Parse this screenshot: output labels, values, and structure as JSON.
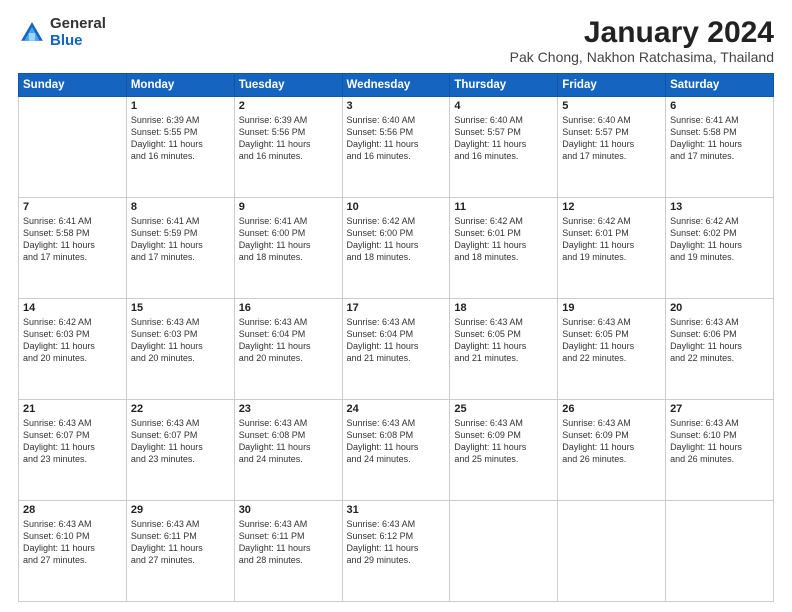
{
  "logo": {
    "general": "General",
    "blue": "Blue"
  },
  "title": {
    "month_year": "January 2024",
    "location": "Pak Chong, Nakhon Ratchasima, Thailand"
  },
  "weekdays": [
    "Sunday",
    "Monday",
    "Tuesday",
    "Wednesday",
    "Thursday",
    "Friday",
    "Saturday"
  ],
  "weeks": [
    [
      {
        "day": "",
        "info": ""
      },
      {
        "day": "1",
        "info": "Sunrise: 6:39 AM\nSunset: 5:55 PM\nDaylight: 11 hours\nand 16 minutes."
      },
      {
        "day": "2",
        "info": "Sunrise: 6:39 AM\nSunset: 5:56 PM\nDaylight: 11 hours\nand 16 minutes."
      },
      {
        "day": "3",
        "info": "Sunrise: 6:40 AM\nSunset: 5:56 PM\nDaylight: 11 hours\nand 16 minutes."
      },
      {
        "day": "4",
        "info": "Sunrise: 6:40 AM\nSunset: 5:57 PM\nDaylight: 11 hours\nand 16 minutes."
      },
      {
        "day": "5",
        "info": "Sunrise: 6:40 AM\nSunset: 5:57 PM\nDaylight: 11 hours\nand 17 minutes."
      },
      {
        "day": "6",
        "info": "Sunrise: 6:41 AM\nSunset: 5:58 PM\nDaylight: 11 hours\nand 17 minutes."
      }
    ],
    [
      {
        "day": "7",
        "info": "Sunrise: 6:41 AM\nSunset: 5:58 PM\nDaylight: 11 hours\nand 17 minutes."
      },
      {
        "day": "8",
        "info": "Sunrise: 6:41 AM\nSunset: 5:59 PM\nDaylight: 11 hours\nand 17 minutes."
      },
      {
        "day": "9",
        "info": "Sunrise: 6:41 AM\nSunset: 6:00 PM\nDaylight: 11 hours\nand 18 minutes."
      },
      {
        "day": "10",
        "info": "Sunrise: 6:42 AM\nSunset: 6:00 PM\nDaylight: 11 hours\nand 18 minutes."
      },
      {
        "day": "11",
        "info": "Sunrise: 6:42 AM\nSunset: 6:01 PM\nDaylight: 11 hours\nand 18 minutes."
      },
      {
        "day": "12",
        "info": "Sunrise: 6:42 AM\nSunset: 6:01 PM\nDaylight: 11 hours\nand 19 minutes."
      },
      {
        "day": "13",
        "info": "Sunrise: 6:42 AM\nSunset: 6:02 PM\nDaylight: 11 hours\nand 19 minutes."
      }
    ],
    [
      {
        "day": "14",
        "info": "Sunrise: 6:42 AM\nSunset: 6:03 PM\nDaylight: 11 hours\nand 20 minutes."
      },
      {
        "day": "15",
        "info": "Sunrise: 6:43 AM\nSunset: 6:03 PM\nDaylight: 11 hours\nand 20 minutes."
      },
      {
        "day": "16",
        "info": "Sunrise: 6:43 AM\nSunset: 6:04 PM\nDaylight: 11 hours\nand 20 minutes."
      },
      {
        "day": "17",
        "info": "Sunrise: 6:43 AM\nSunset: 6:04 PM\nDaylight: 11 hours\nand 21 minutes."
      },
      {
        "day": "18",
        "info": "Sunrise: 6:43 AM\nSunset: 6:05 PM\nDaylight: 11 hours\nand 21 minutes."
      },
      {
        "day": "19",
        "info": "Sunrise: 6:43 AM\nSunset: 6:05 PM\nDaylight: 11 hours\nand 22 minutes."
      },
      {
        "day": "20",
        "info": "Sunrise: 6:43 AM\nSunset: 6:06 PM\nDaylight: 11 hours\nand 22 minutes."
      }
    ],
    [
      {
        "day": "21",
        "info": "Sunrise: 6:43 AM\nSunset: 6:07 PM\nDaylight: 11 hours\nand 23 minutes."
      },
      {
        "day": "22",
        "info": "Sunrise: 6:43 AM\nSunset: 6:07 PM\nDaylight: 11 hours\nand 23 minutes."
      },
      {
        "day": "23",
        "info": "Sunrise: 6:43 AM\nSunset: 6:08 PM\nDaylight: 11 hours\nand 24 minutes."
      },
      {
        "day": "24",
        "info": "Sunrise: 6:43 AM\nSunset: 6:08 PM\nDaylight: 11 hours\nand 24 minutes."
      },
      {
        "day": "25",
        "info": "Sunrise: 6:43 AM\nSunset: 6:09 PM\nDaylight: 11 hours\nand 25 minutes."
      },
      {
        "day": "26",
        "info": "Sunrise: 6:43 AM\nSunset: 6:09 PM\nDaylight: 11 hours\nand 26 minutes."
      },
      {
        "day": "27",
        "info": "Sunrise: 6:43 AM\nSunset: 6:10 PM\nDaylight: 11 hours\nand 26 minutes."
      }
    ],
    [
      {
        "day": "28",
        "info": "Sunrise: 6:43 AM\nSunset: 6:10 PM\nDaylight: 11 hours\nand 27 minutes."
      },
      {
        "day": "29",
        "info": "Sunrise: 6:43 AM\nSunset: 6:11 PM\nDaylight: 11 hours\nand 27 minutes."
      },
      {
        "day": "30",
        "info": "Sunrise: 6:43 AM\nSunset: 6:11 PM\nDaylight: 11 hours\nand 28 minutes."
      },
      {
        "day": "31",
        "info": "Sunrise: 6:43 AM\nSunset: 6:12 PM\nDaylight: 11 hours\nand 29 minutes."
      },
      {
        "day": "",
        "info": ""
      },
      {
        "day": "",
        "info": ""
      },
      {
        "day": "",
        "info": ""
      }
    ]
  ]
}
